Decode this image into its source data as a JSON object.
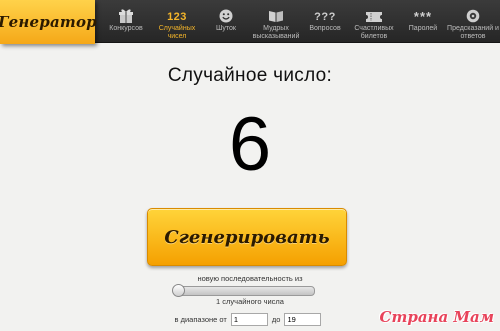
{
  "logo": {
    "text": "Генератор"
  },
  "nav": {
    "items": [
      {
        "label": "Конкурсов",
        "icon": "gift-icon",
        "active": false
      },
      {
        "label": "Случайных чисел",
        "icon": "numbers-icon",
        "icon_text": "123",
        "active": true
      },
      {
        "label": "Шуток",
        "icon": "smiley-icon",
        "active": false
      },
      {
        "label": "Мудрых высказываний",
        "icon": "book-icon",
        "active": false
      },
      {
        "label": "Вопросов",
        "icon": "question-icon",
        "icon_text": "???",
        "active": false
      },
      {
        "label": "Счастливых билетов",
        "icon": "ticket-icon",
        "active": false
      },
      {
        "label": "Паролей",
        "icon": "password-icon",
        "icon_text": "***",
        "active": false
      },
      {
        "label": "Предсказаний и ответов",
        "icon": "crystal-ball-icon",
        "active": false
      }
    ]
  },
  "main": {
    "heading": "Случайное число:",
    "result": "6",
    "button_label": "Сгенерировать"
  },
  "controls": {
    "sequence_label": "новую последовательность из",
    "count_label": "1 случайного числа",
    "range_from_label": "в диапазоне от",
    "range_to_label": "до",
    "range_from_value": "1",
    "range_to_value": "19"
  },
  "watermark": {
    "text": "Страна Мам"
  },
  "colors": {
    "accent": "#f4b52a",
    "topbar": "#2e2e2e",
    "button_top": "#ffd43a",
    "button_bottom": "#f5a000",
    "watermark": "#e8435a"
  }
}
